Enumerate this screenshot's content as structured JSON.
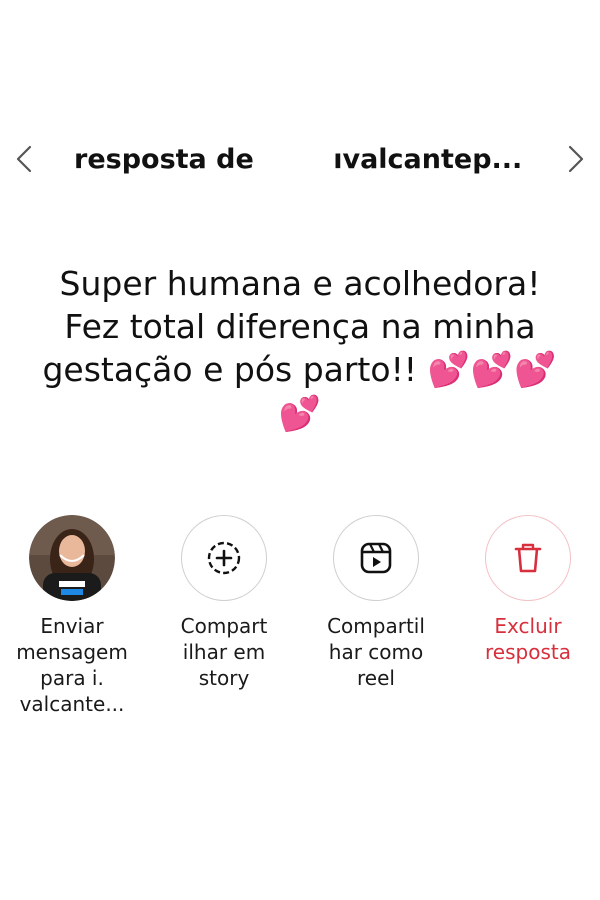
{
  "header": {
    "title_prefix": "resposta de",
    "title_suffix": "ıvalcantep...",
    "prev_icon": "chevron-left-icon",
    "next_icon": "chevron-right-icon"
  },
  "reply": {
    "line1": "Super humana e acolhedora!",
    "line2": "Fez total diferença na minha",
    "line3": "gestação e pós parto!!",
    "hearts_inline": "💕💕💕",
    "hearts_last": "💕"
  },
  "actions": [
    {
      "label": "Enviar\nmensagem\npara i.\nvalcante...",
      "icon": "avatar"
    },
    {
      "label": "Compart\nilhar em\nstory",
      "icon": "add-to-story-icon"
    },
    {
      "label": "Compartil\nhar como\nreel",
      "icon": "reel-icon"
    },
    {
      "label": "Excluir\nresposta",
      "icon": "trash-icon"
    }
  ],
  "colors": {
    "danger": "#d82f3d",
    "hearts": "#f45da6",
    "text": "#111111"
  }
}
